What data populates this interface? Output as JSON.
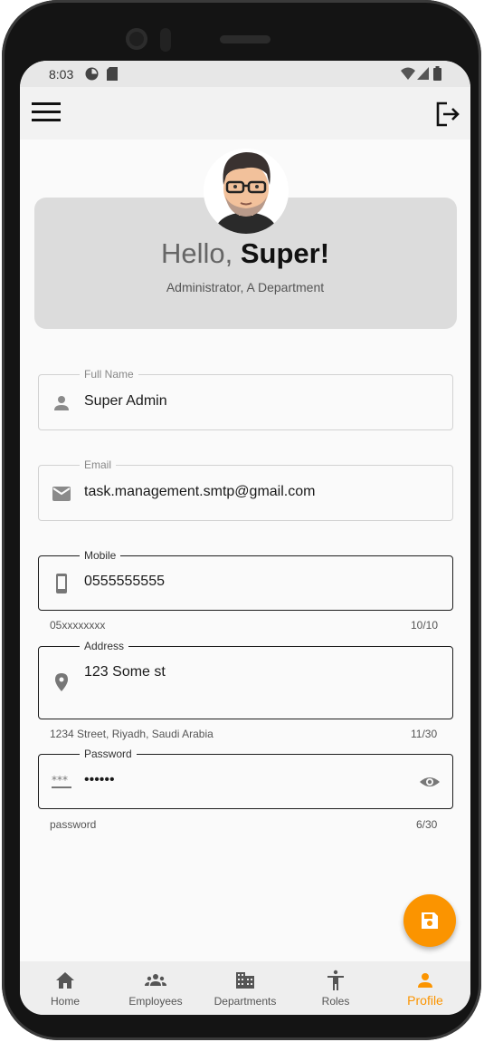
{
  "status_bar": {
    "time": "8:03"
  },
  "colors": {
    "accent": "#fb9400",
    "card": "#dcdcdc",
    "background": "#fafafa"
  },
  "app_bar": {
    "menu_icon": "menu-icon",
    "logout_icon": "logout-icon"
  },
  "profile": {
    "greeting_prefix": "Hello, ",
    "name": "Super!",
    "subtitle": "Administrator, A Department"
  },
  "form": {
    "full_name": {
      "label": "Full Name",
      "value": "Super Admin",
      "icon": "person-icon"
    },
    "email": {
      "label": "Email",
      "value": "task.management.smtp@gmail.com",
      "icon": "mail-icon"
    },
    "mobile": {
      "label": "Mobile",
      "value": "0555555555",
      "icon": "phone-icon",
      "helper": "05xxxxxxxx",
      "counter": "10/10"
    },
    "address": {
      "label": "Address",
      "value": "123 Some st",
      "icon": "location-icon",
      "helper": "1234 Street, Riyadh, Saudi Arabia",
      "counter": "11/30"
    },
    "password": {
      "label": "Password",
      "value": "••••••",
      "icon": "password-icon",
      "helper": "password",
      "counter": "6/30"
    }
  },
  "fab": {
    "icon": "save-icon"
  },
  "bottom_nav": {
    "items": [
      {
        "label": "Home",
        "icon": "home-icon"
      },
      {
        "label": "Employees",
        "icon": "groups-icon"
      },
      {
        "label": "Departments",
        "icon": "building-icon"
      },
      {
        "label": "Roles",
        "icon": "accessibility-icon"
      },
      {
        "label": "Profile",
        "icon": "person-icon",
        "active": true
      }
    ]
  }
}
